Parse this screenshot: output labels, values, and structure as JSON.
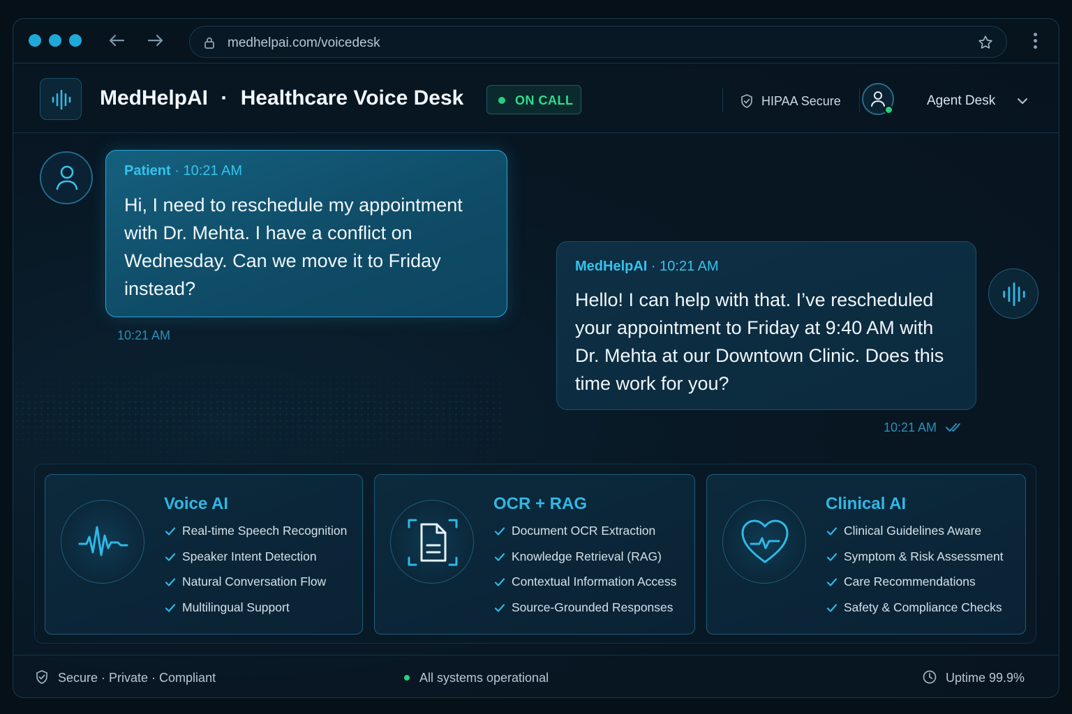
{
  "browser": {
    "url": "medhelpai.com/voicedesk"
  },
  "header": {
    "brand": "MedHelpAI",
    "separator": "·",
    "subtitle": "Healthcare Voice Desk",
    "status": "ON CALL",
    "security": "HIPAA Secure",
    "agent": "Agent Desk"
  },
  "chat": {
    "patient": {
      "sender": "Patient",
      "time_sep": "·",
      "time": "10:21 AM",
      "text": "Hi, I need to reschedule my appointment with Dr. Mehta. I have a conflict on Wednesday. Can we move it to Friday instead?",
      "timestamp": "10:21 AM"
    },
    "assistant": {
      "sender": "MedHelpAI",
      "time_sep": "·",
      "time": "10:21 AM",
      "text": "Hello! I can help with that. I’ve rescheduled your appointment to Friday at 9:40 AM with Dr. Mehta at our Downtown Clinic. Does this time work for you?",
      "timestamp": "10:21 AM"
    }
  },
  "features": [
    {
      "title": "Voice AI",
      "icon": "waveform-icon",
      "items": [
        "Real-time Speech Recognition",
        "Speaker Intent Detection",
        "Natural Conversation Flow",
        "Multilingual Support"
      ]
    },
    {
      "title": "OCR + RAG",
      "icon": "document-scan-icon",
      "items": [
        "Document OCR Extraction",
        "Knowledge Retrieval (RAG)",
        "Contextual Information Access",
        "Source-Grounded Responses"
      ]
    },
    {
      "title": "Clinical AI",
      "icon": "heart-pulse-icon",
      "items": [
        "Clinical Guidelines Aware",
        "Symptom & Risk Assessment",
        "Care Recommendations",
        "Safety & Compliance Checks"
      ]
    }
  ],
  "footer": {
    "left": "Secure · Private · Compliant",
    "middle": "All systems operational",
    "right": "Uptime 99.9%"
  },
  "colors": {
    "accent": "#2fb8e6",
    "online": "#27d07d",
    "background": "#071420"
  }
}
